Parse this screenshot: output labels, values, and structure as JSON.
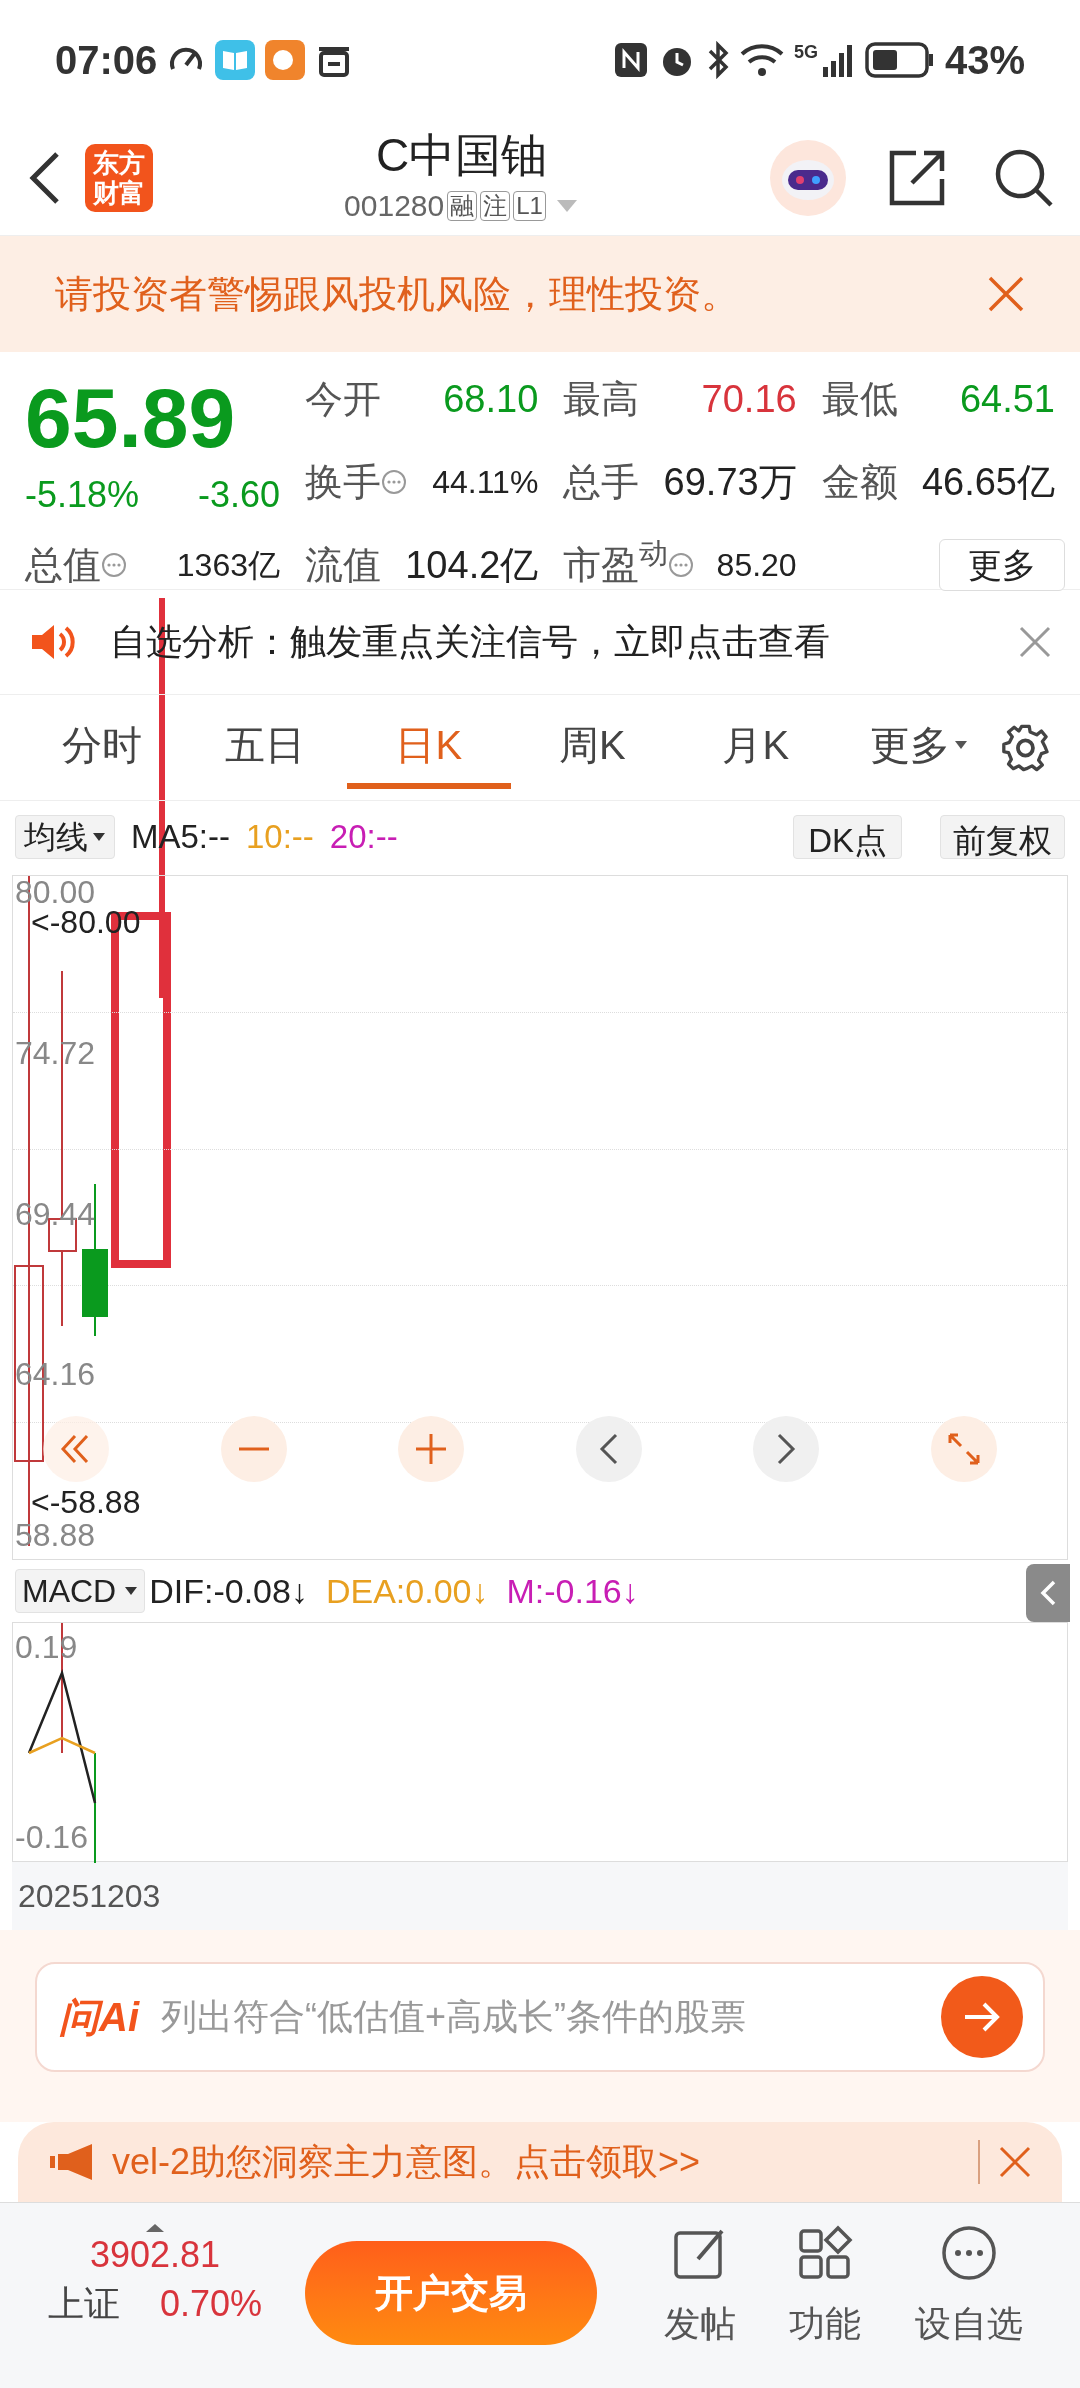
{
  "status_bar": {
    "time": "07:06",
    "network": "5G",
    "battery": "43%"
  },
  "header": {
    "logo_text": "东方财富",
    "title": "C中国铀",
    "code": "001280",
    "tags": [
      "融",
      "注",
      "L1"
    ]
  },
  "risk_banner": {
    "text": "请投资者警惕跟风投机风险，理性投资。"
  },
  "quote": {
    "price": "65.89",
    "change_pct": "-5.18%",
    "change": "-3.60",
    "color": "#0a9a1e",
    "fields": [
      {
        "label": "今开",
        "value": "68.10",
        "color": "#0a9a1e",
        "info": false
      },
      {
        "label": "最高",
        "value": "70.16",
        "color": "#d8343c",
        "info": false
      },
      {
        "label": "最低",
        "value": "64.51",
        "color": "#0a9a1e",
        "info": false
      },
      {
        "label": "换手",
        "value": "44.11%",
        "color": "#222222",
        "info": true
      },
      {
        "label": "总手",
        "value": "69.73万",
        "color": "#222222",
        "info": false
      },
      {
        "label": "金额",
        "value": "46.65亿",
        "color": "#222222",
        "info": false
      },
      {
        "label": "总值",
        "value": "1363亿",
        "color": "#222222",
        "info": true
      },
      {
        "label": "流值",
        "value": "104.2亿",
        "color": "#222222",
        "info": false
      },
      {
        "label": "市盈$^{动}$",
        "value": "85.20",
        "color": "#222222",
        "info": true
      }
    ],
    "more_button": "更多"
  },
  "notice": {
    "text": "自选分析：触发重点关注信号，立即点击查看"
  },
  "period_tabs": [
    {
      "label": "分时",
      "selected": false
    },
    {
      "label": "五日",
      "selected": false
    },
    {
      "label": "日K",
      "selected": true
    },
    {
      "label": "周K",
      "selected": false
    },
    {
      "label": "月K",
      "selected": false
    },
    {
      "label": "更多",
      "selected": false
    }
  ],
  "indicators": {
    "selector": "均线",
    "ma": [
      {
        "text": "MA5:--",
        "color": "#222222"
      },
      {
        "text": "10:--",
        "color": "#e8a020"
      },
      {
        "text": "20:--",
        "color": "#c81eb4"
      }
    ],
    "dk": "DK点",
    "adjust": "前复权"
  },
  "chart": {
    "y_labels": [
      "80.00",
      "74.72",
      "69.44",
      "64.16",
      "58.88"
    ],
    "high_marker": "<-80.00",
    "low_marker": "<-58.88"
  },
  "macd": {
    "selector": "MACD",
    "values": [
      {
        "text": "DIF:-0.08↓",
        "color": "#222222"
      },
      {
        "text": "DEA:0.00↓",
        "color": "#e8a020"
      },
      {
        "text": "M:-0.16↓",
        "color": "#c81eb4"
      }
    ],
    "y_labels": [
      "0.19",
      "-0.16"
    ]
  },
  "date": "20251203",
  "ai_search": {
    "logo_text": "问Ai",
    "placeholder": "列出符合“低估值+高成长”条件的股票"
  },
  "promo": {
    "text": "vel-2助您洞察主力意图。点击领取>>"
  },
  "bottom_bar": {
    "index_value": "3902.81",
    "index_name": "上证",
    "index_change": "0.70%",
    "trade_button": "开户交易",
    "actions": [
      {
        "label": "发帖",
        "kind": "post"
      },
      {
        "label": "功能",
        "kind": "apps"
      },
      {
        "label": "设自选",
        "kind": "more"
      }
    ]
  }
}
